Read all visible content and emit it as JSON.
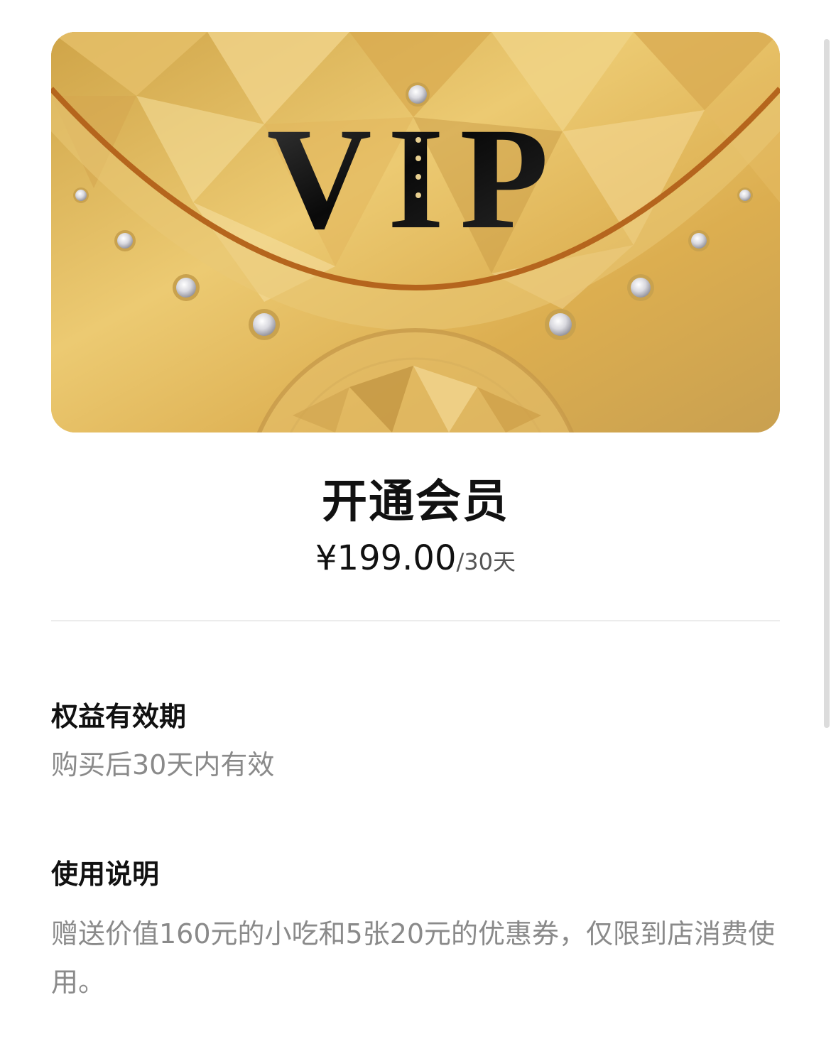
{
  "card": {
    "logo_text": "VIP",
    "colors": {
      "gold_light": "#f1d68a",
      "gold_mid": "#e0b655",
      "gold_dark": "#b8862f",
      "arc": "#b5651d",
      "letters": "#0d0d0d"
    }
  },
  "header": {
    "title": "开通会员",
    "price": "¥199.00",
    "price_unit": "/30天"
  },
  "sections": [
    {
      "title": "权益有效期",
      "text": "购买后30天内有效"
    },
    {
      "title": "使用说明",
      "text": "赠送价值160元的小吃和5张20元的优惠券，仅限到店消费使用。"
    }
  ]
}
